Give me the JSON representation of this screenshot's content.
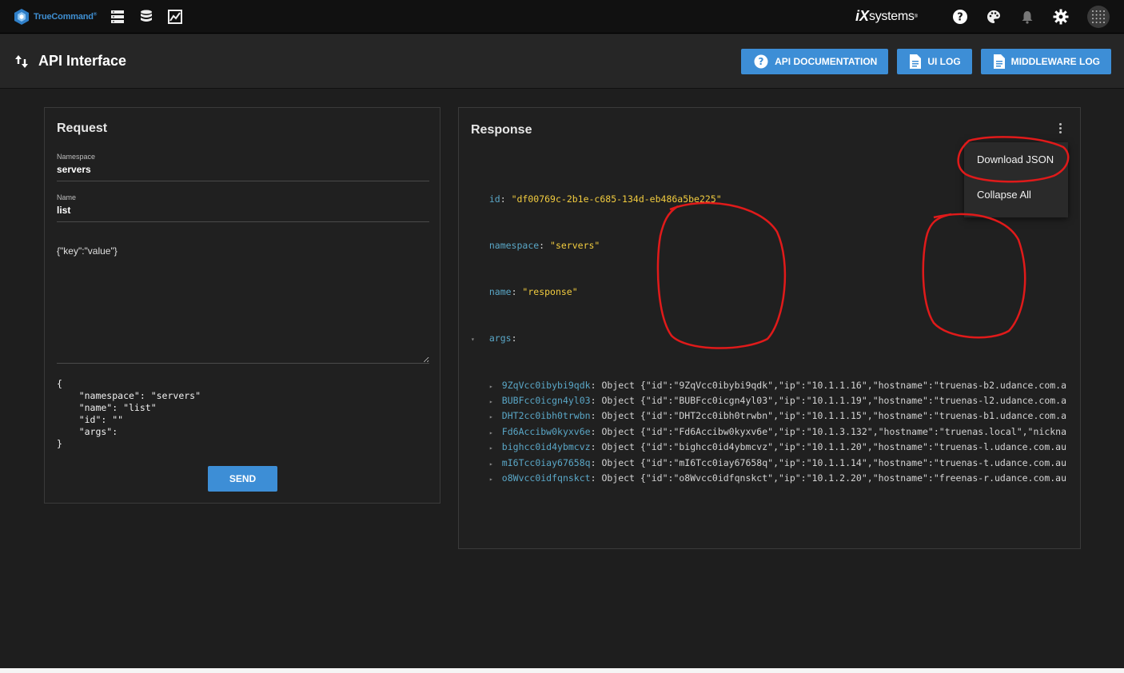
{
  "topbar": {
    "logo_text": "TrueCommand",
    "logo_mark": "®",
    "nav_icons": [
      "servers-icon",
      "database-icon",
      "chart-icon"
    ],
    "vendor_logo_ix": "iX",
    "vendor_logo_rest": "systems",
    "vendor_mark": "®",
    "right_icons": [
      "help-icon",
      "palette-icon",
      "bell-icon",
      "gear-icon",
      "apps-grid-icon"
    ]
  },
  "header": {
    "title": "API Interface",
    "buttons": {
      "api_docs": "API DOCUMENTATION",
      "ui_log": "UI LOG",
      "middleware_log": "MIDDLEWARE LOG"
    },
    "accent": "#3d8ed6"
  },
  "request": {
    "title": "Request",
    "namespace_label": "Namespace",
    "namespace_value": "servers",
    "name_label": "Name",
    "name_value": "list",
    "args_value": "{\"key\":\"value\"}",
    "preview": {
      "open": "{",
      "namespace_line": "    \"namespace\": \"servers\"",
      "name_line": "    \"name\": \"list\"",
      "id_line": "    \"id\": \"\"",
      "args_line": "    \"args\":",
      "close": "}"
    },
    "send_label": "SEND"
  },
  "response": {
    "title": "Response",
    "id_key": "id",
    "id_value": "\"df00769c-2b1e-c685-134d-eb486a5be225\"",
    "namespace_key": "namespace",
    "namespace_value": "\"servers\"",
    "name_key": "name",
    "name_value": "\"response\"",
    "args_key": "args",
    "args": [
      {
        "key": "9ZqVcc0ibybi9qdk",
        "summary": "Object {\"id\":\"9ZqVcc0ibybi9qdk\",\"ip\":\"10.1.1.16\",\"hostname\":\"truenas-b2.udance.com.a"
      },
      {
        "key": "BUBFcc0icgn4yl03",
        "summary": "Object {\"id\":\"BUBFcc0icgn4yl03\",\"ip\":\"10.1.1.19\",\"hostname\":\"truenas-l2.udance.com.a"
      },
      {
        "key": "DHT2cc0ibh0trwbn",
        "summary": "Object {\"id\":\"DHT2cc0ibh0trwbn\",\"ip\":\"10.1.1.15\",\"hostname\":\"truenas-b1.udance.com.a"
      },
      {
        "key": "Fd6Accibw0kyxv6e",
        "summary": "Object {\"id\":\"Fd6Accibw0kyxv6e\",\"ip\":\"10.1.3.132\",\"hostname\":\"truenas.local\",\"nicknam"
      },
      {
        "key": "bighcc0id4ybmcvz",
        "summary": "Object {\"id\":\"bighcc0id4ybmcvz\",\"ip\":\"10.1.1.20\",\"hostname\":\"truenas-l.udance.com.au"
      },
      {
        "key": "mI6Tcc0iay67658q",
        "summary": "Object {\"id\":\"mI6Tcc0iay67658q\",\"ip\":\"10.1.1.14\",\"hostname\":\"truenas-t.udance.com.au"
      },
      {
        "key": "o8Wvcc0idfqnskct",
        "summary": "Object {\"id\":\"o8Wvcc0idfqnskct\",\"ip\":\"10.1.2.20\",\"hostname\":\"freenas-r.udance.com.au"
      }
    ]
  },
  "menu": {
    "download_json": "Download JSON",
    "collapse_all": "Collapse All"
  },
  "annotation_color": "#e01a1a"
}
